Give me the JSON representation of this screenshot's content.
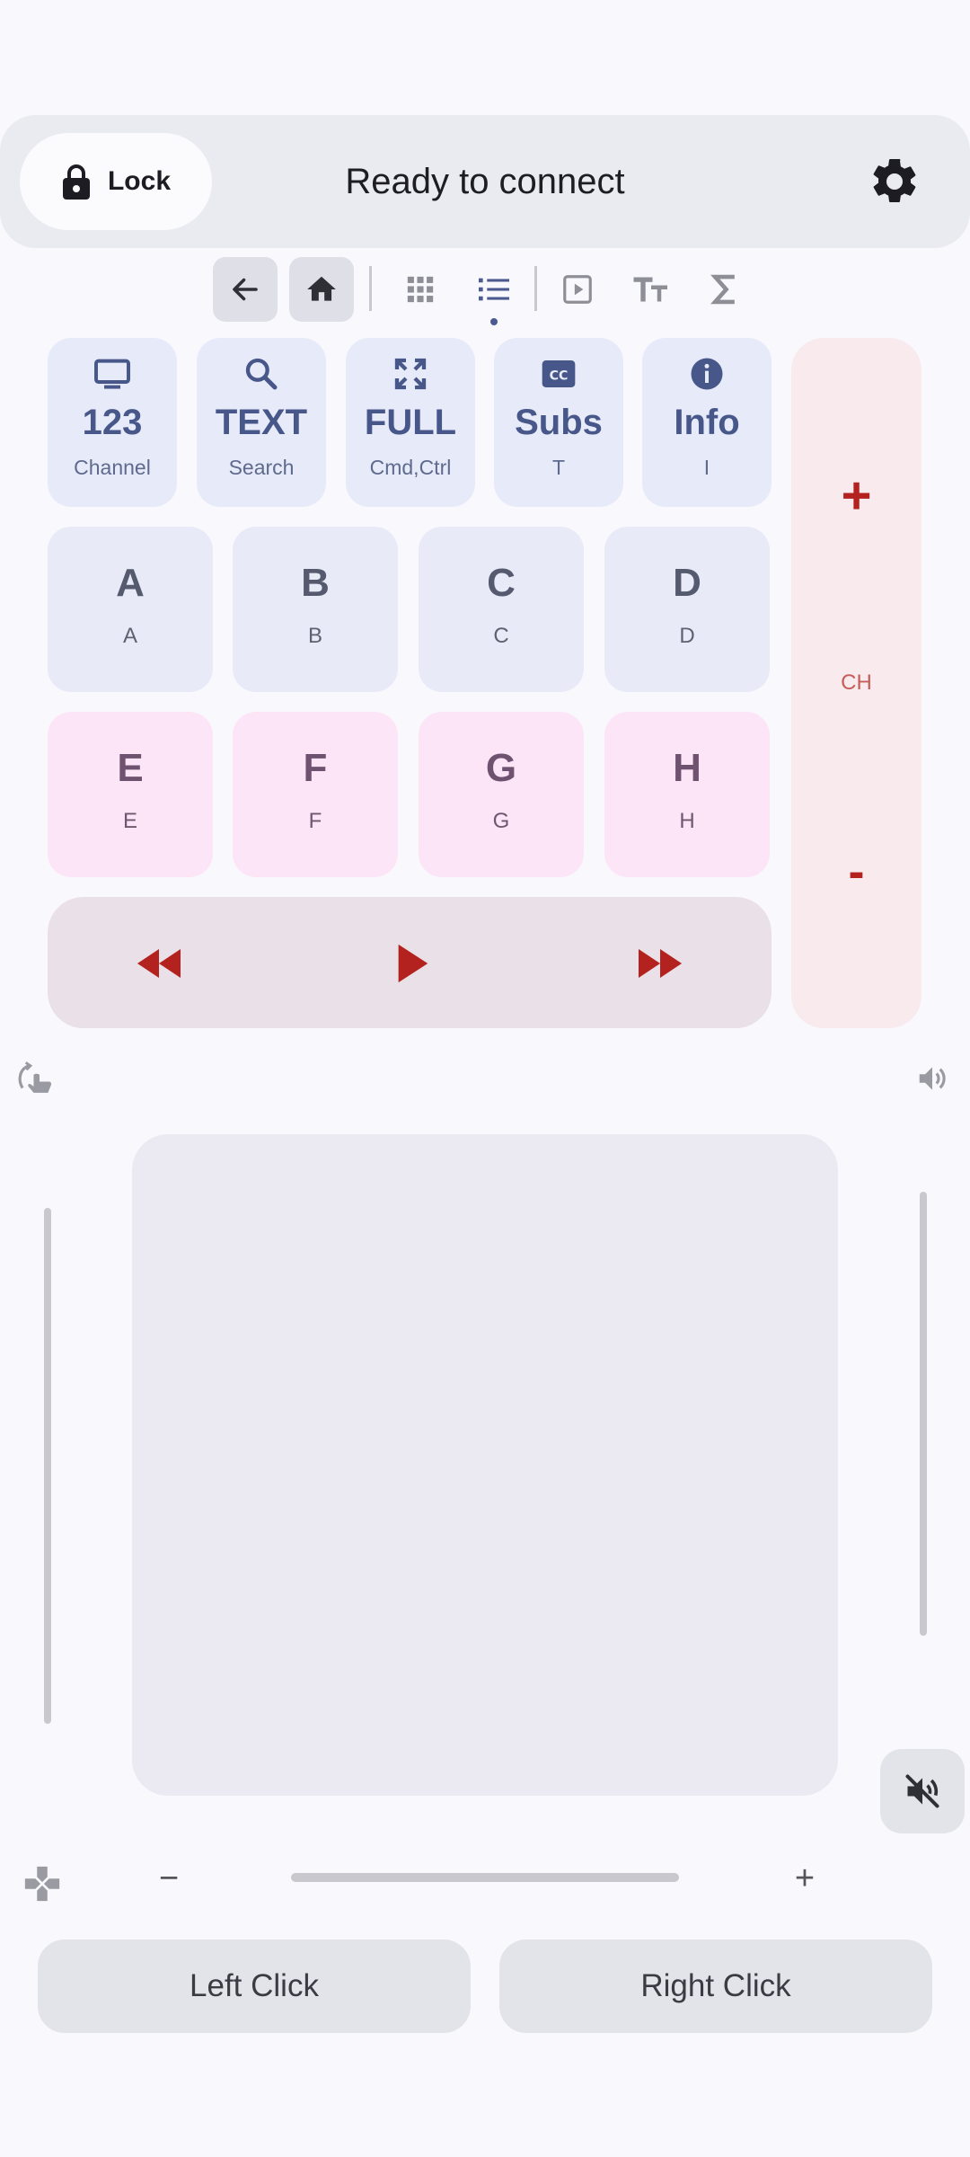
{
  "header": {
    "lock_label": "Lock",
    "status": "Ready to connect"
  },
  "toolbar": {
    "icons": [
      "back-arrow-icon",
      "home-icon",
      "grid-icon",
      "list-icon",
      "play-box-icon",
      "text-size-icon",
      "sigma-icon"
    ],
    "selected": [
      "back-arrow-icon",
      "home-icon"
    ],
    "active_page": "list-icon"
  },
  "keys_top": [
    {
      "icon": "tv-icon",
      "big": "123",
      "small": "Channel"
    },
    {
      "icon": "search-icon",
      "big": "TEXT",
      "small": "Search"
    },
    {
      "icon": "fullscreen-icon",
      "big": "FULL",
      "small": "Cmd,Ctrl"
    },
    {
      "icon": "cc-icon",
      "big": "Subs",
      "small": "T"
    },
    {
      "icon": "info-icon",
      "big": "Info",
      "small": "I"
    }
  ],
  "keys_ad": [
    {
      "big": "A",
      "small": "A"
    },
    {
      "big": "B",
      "small": "B"
    },
    {
      "big": "C",
      "small": "C"
    },
    {
      "big": "D",
      "small": "D"
    }
  ],
  "keys_eh": [
    {
      "big": "E",
      "small": "E"
    },
    {
      "big": "F",
      "small": "F"
    },
    {
      "big": "G",
      "small": "G"
    },
    {
      "big": "H",
      "small": "H"
    }
  ],
  "channel": {
    "plus": "+",
    "label": "CH",
    "minus": "-"
  },
  "sensitivity": {
    "minus": "−",
    "plus": "+"
  },
  "clicks": {
    "left": "Left Click",
    "right": "Right Click"
  },
  "colors": {
    "accent_red": "#b3221f",
    "key_blue": "#47578a",
    "key_pink_bg": "#fde5f8"
  }
}
